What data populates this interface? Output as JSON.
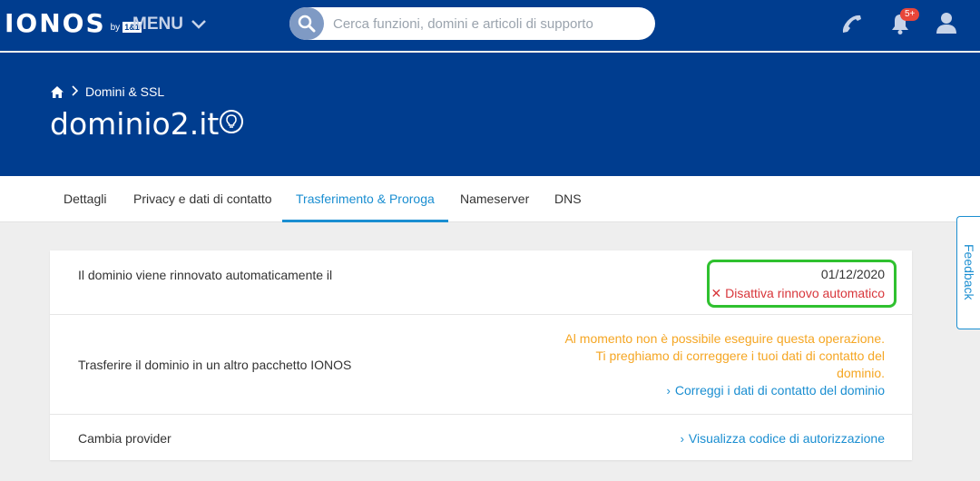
{
  "topbar": {
    "logo_text": "IONOS",
    "logo_by": "by",
    "logo_brand": "1&1",
    "menu_label": "MENU",
    "search_placeholder": "Cerca funzioni, domini e articoli di supporto",
    "notifications_badge": "5+",
    "bg_color": "#003d8f"
  },
  "header": {
    "breadcrumb": {
      "home_icon": "home-icon",
      "item": "Domini & SSL"
    },
    "title": "dominio2.it",
    "bulb_icon": "lightbulb-icon"
  },
  "tabs": [
    {
      "label": "Dettagli",
      "active": false
    },
    {
      "label": "Privacy e dati di contatto",
      "active": false
    },
    {
      "label": "Trasferimento & Proroga",
      "active": true
    },
    {
      "label": "Nameserver",
      "active": false
    },
    {
      "label": "DNS",
      "active": false
    }
  ],
  "rows": {
    "renewal": {
      "label": "Il dominio viene rinnovato automaticamente il",
      "date": "01/12/2020",
      "action": "Disattiva rinnovo automatico"
    },
    "transfer": {
      "label": "Trasferire il dominio in un altro pacchetto IONOS",
      "warning_line1": "Al momento non è possibile eseguire questa operazione.",
      "warning_line2": "Ti preghiamo di correggere i tuoi dati di contatto del",
      "warning_line3": "dominio.",
      "action": "Correggi i dati di contatto del dominio"
    },
    "provider": {
      "label": "Cambia provider",
      "action": "Visualizza codice di autorizzazione"
    }
  },
  "feedback_label": "Feedback",
  "colors": {
    "accent_blue": "#1a8ed1",
    "warning_orange": "#f5a623",
    "danger_red": "#d8363b",
    "highlight_green": "#2fc12f"
  }
}
